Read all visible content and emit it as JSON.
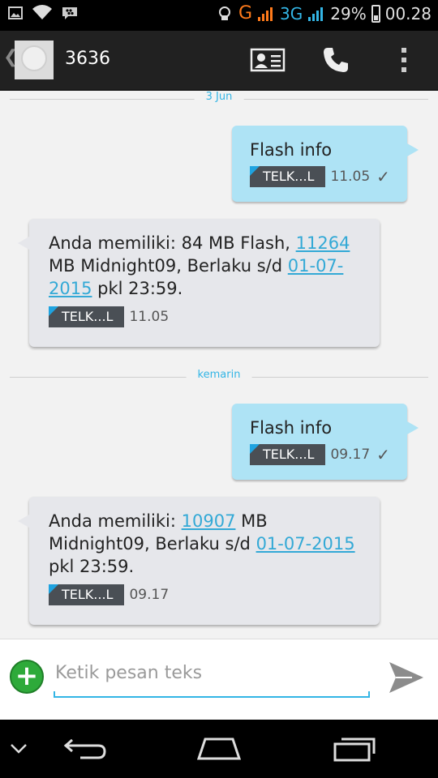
{
  "status_bar": {
    "network_g": "G",
    "network_3g": "3G",
    "battery_pct": "29%",
    "time": "00.28"
  },
  "header": {
    "back_glyph": "❮",
    "contact": "3636",
    "icons": [
      "contact-card-icon",
      "phone-icon",
      "overflow-menu-icon"
    ]
  },
  "conversation": {
    "separators": [
      {
        "label": "3 Jun"
      },
      {
        "label": "kemarin"
      }
    ],
    "messages": [
      {
        "direction": "out",
        "text": "Flash info",
        "sim": "TELK...L",
        "time": "11.05",
        "status": "✓"
      },
      {
        "direction": "in",
        "parts": [
          "Anda memiliki: 84 MB Flash, ",
          "11264",
          " MB Midnight09,  Berlaku s/d ",
          "01-07-2015",
          " pkl 23:59."
        ],
        "links": [
          "11264",
          "01-07-2015"
        ],
        "sim": "TELK...L",
        "time": "11.05"
      },
      {
        "direction": "out",
        "text": "Flash info",
        "sim": "TELK...L",
        "time": "09.17",
        "status": "✓"
      },
      {
        "direction": "in",
        "parts": [
          "Anda memiliki: ",
          "10907",
          " MB Midnight09,  Berlaku s/d ",
          "01-07-2015",
          " pkl 23:59."
        ],
        "links": [
          "10907",
          "01-07-2015"
        ],
        "sim": "TELK...L",
        "time": "09.17"
      }
    ]
  },
  "compose": {
    "add_glyph": "+",
    "placeholder": "Ketik pesan teks"
  },
  "nav_bar": {
    "buttons": [
      "hide-keyboard-icon",
      "back-icon",
      "home-icon",
      "recents-icon"
    ]
  },
  "colors": {
    "accent": "#33b5e5",
    "outgoing_bubble": "#aee3f5",
    "incoming_bubble": "#e6e7eb",
    "sim_badge": "#4a4f55",
    "add_button": "#2eaa3a"
  }
}
